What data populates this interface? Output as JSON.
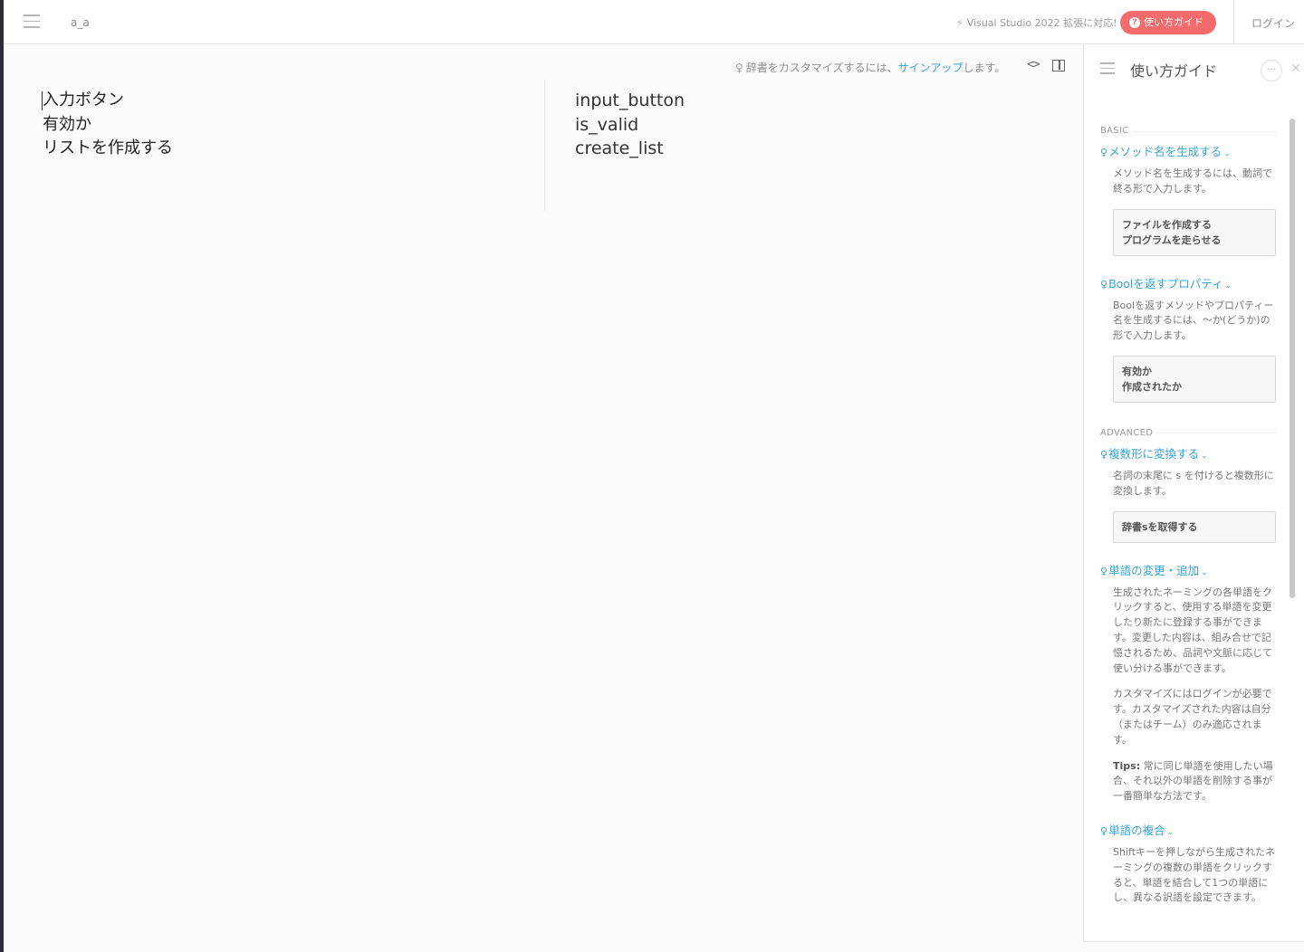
{
  "header": {
    "case_label": "a_a",
    "vs_note": "Visual Studio 2022 拡張に対応!",
    "guide_button": "使い方ガイド",
    "login": "ログイン"
  },
  "editor": {
    "dict_note_prefix": "辞書をカスタマイズするには、",
    "dict_note_link": "サインアップ",
    "dict_note_suffix": "します。",
    "inputs": [
      "入力ボタン",
      "有効か",
      "リストを作成する"
    ],
    "outputs": [
      "input_button",
      "is_valid",
      "create_list"
    ]
  },
  "guide": {
    "title": "使い方ガイド",
    "basic_label": "BASIC",
    "advanced_label": "ADVANCED",
    "items": [
      {
        "title": "メソッド名を生成する",
        "desc": "メソッド名を生成するには、動詞で終る形で入力します。",
        "example": [
          "ファイルを作成する",
          "プログラムを走らせる"
        ]
      },
      {
        "title": "Boolを返すプロパティ",
        "desc": "Boolを返すメソッドやプロパティー名を生成するには、〜か(どうか)の形で入力します。",
        "example": [
          "有効か",
          "作成されたか"
        ]
      },
      {
        "title": "複数形に変換する",
        "desc": "名詞の末尾に s を付けると複数形に変換します。",
        "example": [
          "辞書sを取得する"
        ]
      },
      {
        "title": "単語の変更・追加",
        "desc": "生成されたネーミングの各単語をクリックすると、使用する単語を変更したり新たに登録する事ができます。変更した内容は、組み合せで記憶されるため、品詞や文脈に応じて使い分ける事ができます。",
        "desc2": "カスタマイズにはログインが必要です。カスタマイズされた内容は自分（またはチーム）のみ適応されます。",
        "tips_label": "Tips:",
        "tips": "常に同じ単語を使用したい場合、それ以外の単語を削除する事が一番簡単な方法です。"
      },
      {
        "title": "単語の複合",
        "desc": "Shiftキーを押しながら生成されたネーミングの複数の単語をクリックすると、単語を結合して1つの単語にし、異なる訳語を設定できます。"
      }
    ]
  }
}
